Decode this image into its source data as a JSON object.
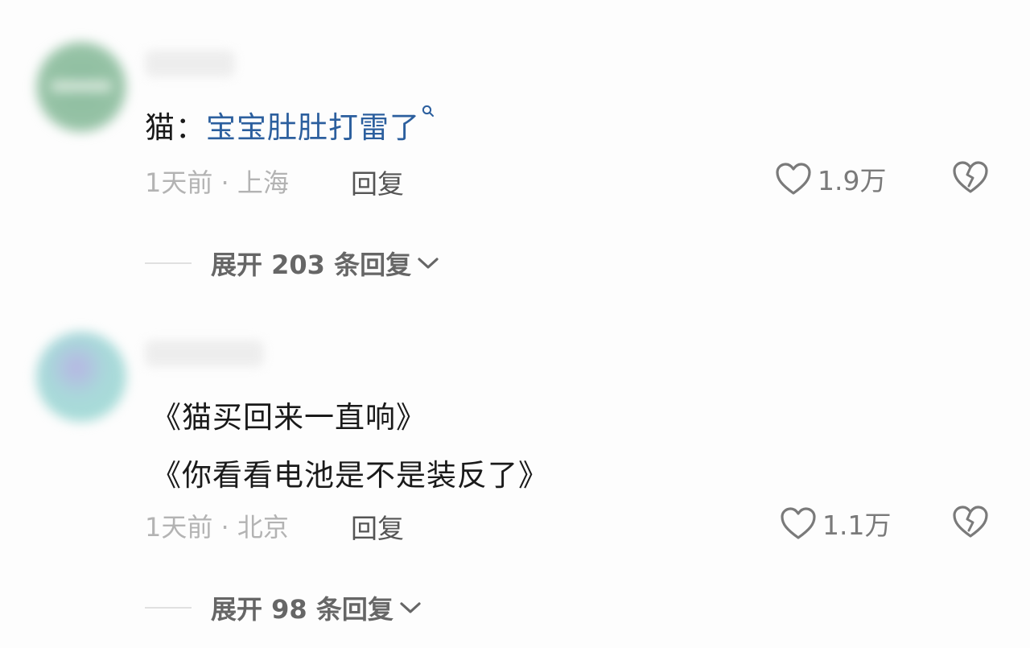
{
  "comments": [
    {
      "text_prefix": "猫：",
      "text_highlight": "宝宝肚肚打雷了",
      "time": "1天前",
      "separator": " · ",
      "location": "上海",
      "reply_label": "回复",
      "likes": "1.9万",
      "expand_label": "展开 203 条回复"
    },
    {
      "line1": "《猫买回来一直响》",
      "line2": "《你看看电池是不是装反了》",
      "time": "1天前",
      "separator": " · ",
      "location": "北京",
      "reply_label": "回复",
      "likes": "1.1万",
      "expand_label": "展开 98 条回复"
    }
  ],
  "colors": {
    "highlight": "#2c5f9e",
    "text": "#1a1a1a",
    "meta": "#b3b3b3"
  },
  "icons": [
    "search-icon",
    "heart-icon",
    "broken-heart-icon",
    "chevron-down-icon"
  ]
}
